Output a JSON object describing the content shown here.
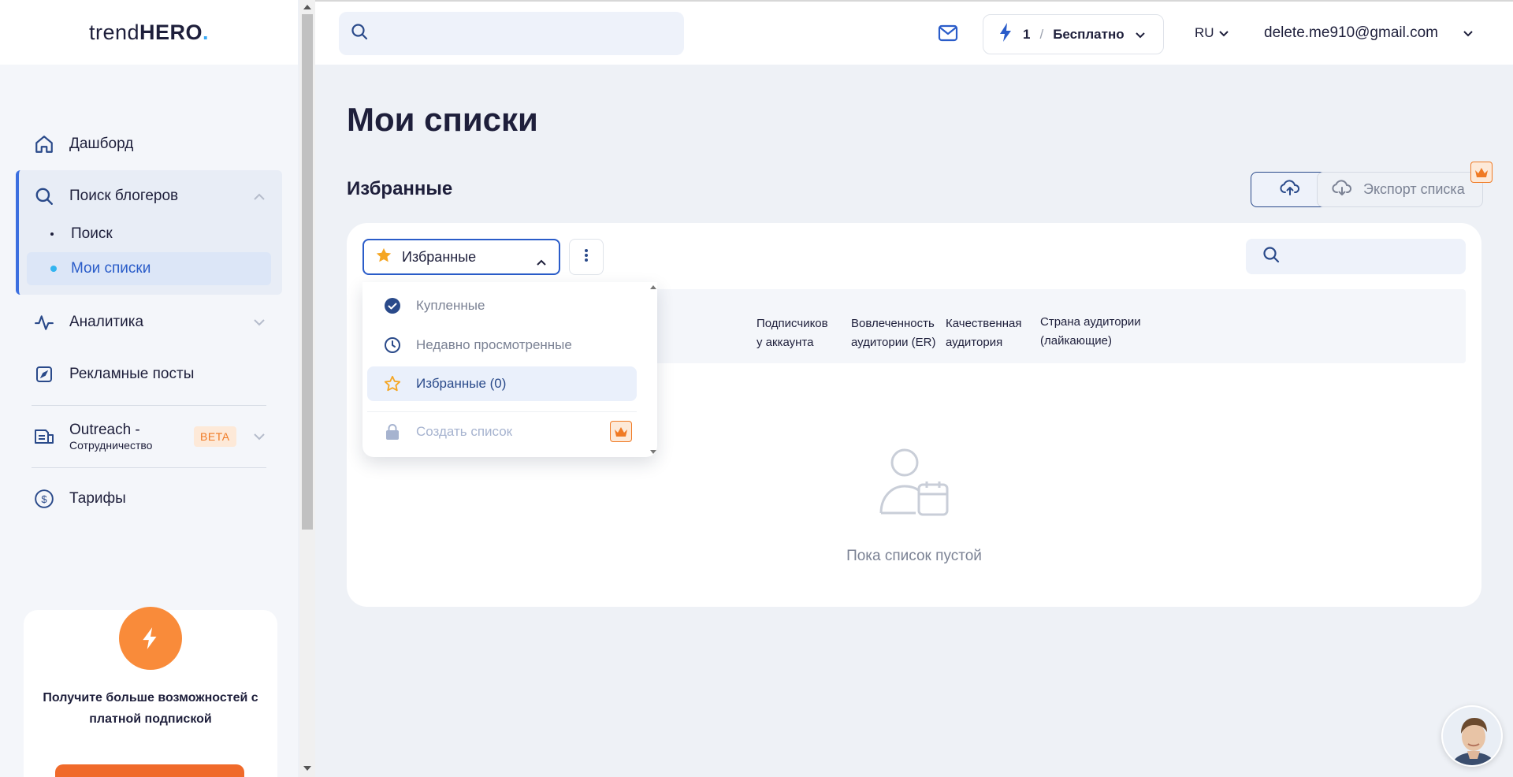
{
  "app": {
    "logo_light": "trend",
    "logo_bold": "HERO",
    "logo_dot": "."
  },
  "sidebar": {
    "dashboard": "Дашборд",
    "search_bloggers": "Поиск блогеров",
    "sub_search": "Поиск",
    "sub_my_lists": "Мои списки",
    "analytics": "Аналитика",
    "ad_posts": "Рекламные посты",
    "outreach_title": "Outreach -",
    "outreach_sub": "Сотрудничество",
    "beta": "BETA",
    "tariffs": "Тарифы",
    "promo_text": "Получите больше возможностей с платной подпиской"
  },
  "header": {
    "search_placeholder": "",
    "plan_count": "1",
    "plan_sep": "/",
    "plan_name": "Бесплатно",
    "lang": "RU",
    "user_email": "delete.me910@gmail.com"
  },
  "main": {
    "page_title": "Мои списки",
    "section_title": "Избранные",
    "export_label": "Экспорт списка",
    "selected_list": "Избранные",
    "columns": [
      {
        "line1": "Подписчиков",
        "line2": "у аккаунта"
      },
      {
        "line1": "Вовлеченность",
        "line2": "аудитории (ER)"
      },
      {
        "line1": "Качественная",
        "line2": "аудитория"
      },
      {
        "line1": "Страна аудитории",
        "line2": "(лайкающие)"
      }
    ],
    "empty_text": "Пока список пустой"
  },
  "dropdown": {
    "items": [
      {
        "label": "Купленные"
      },
      {
        "label": "Недавно просмотренные"
      },
      {
        "label": "Избранные (0)"
      },
      {
        "label": "Создать список"
      }
    ]
  },
  "colors": {
    "primary": "#2a5cc9",
    "accent_orange": "#f98b3a",
    "text_dark": "#1e1f3b",
    "muted": "#7b8294"
  }
}
